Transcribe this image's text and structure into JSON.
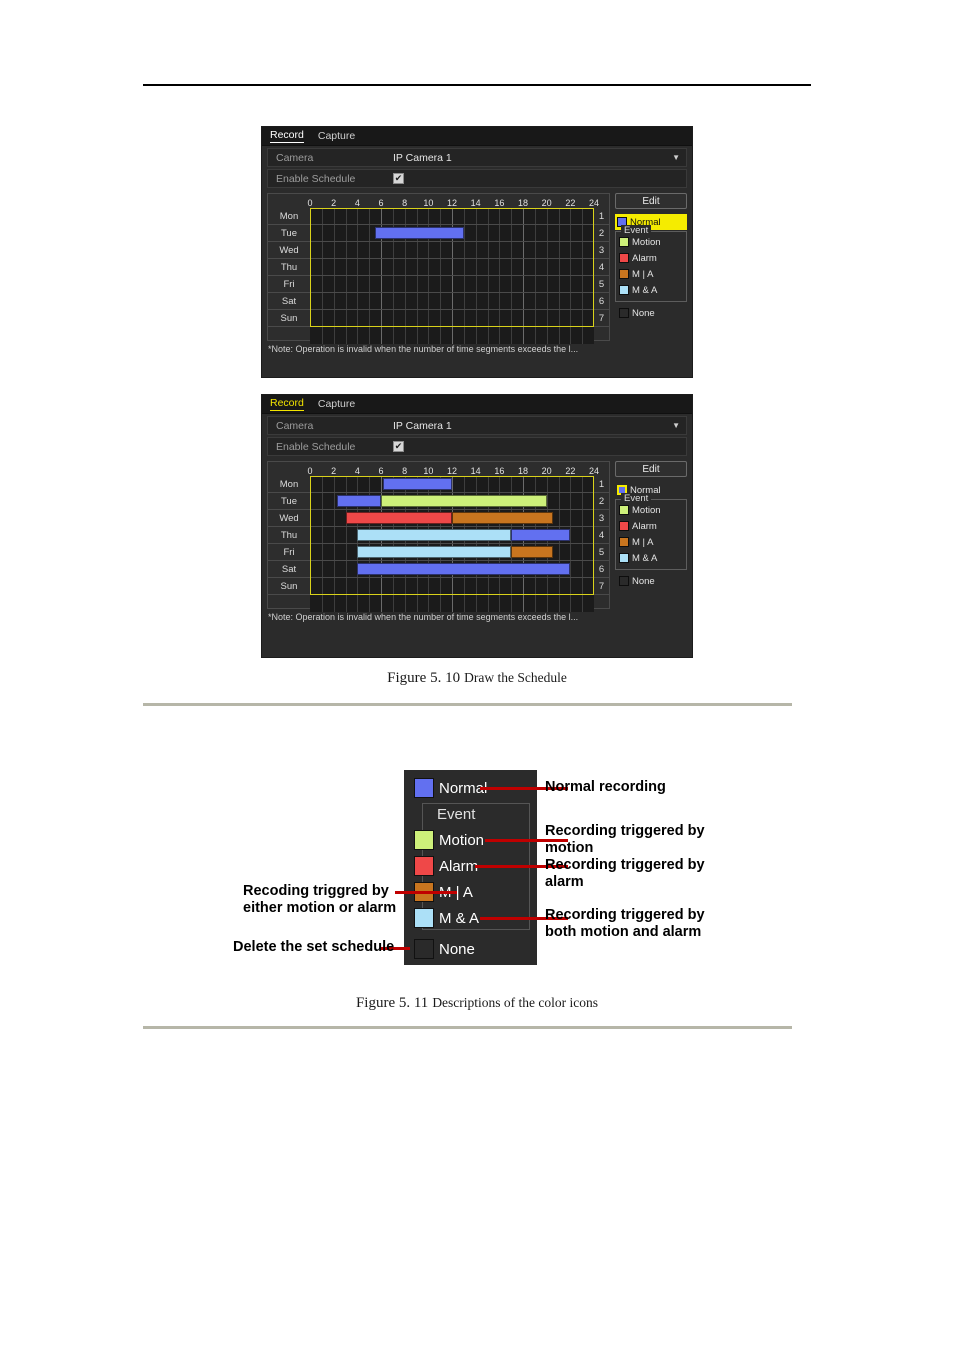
{
  "document": {
    "figure1_caption_label": "Figure 5. 10",
    "figure1_caption_text": "Draw the Schedule",
    "figure2_caption_label": "Figure 5. 11",
    "figure2_caption_text": "Descriptions of the color icons"
  },
  "colors": {
    "normal": "#6270f0",
    "motion": "#cdf07a",
    "alarm": "#ef4848",
    "m_or_a": "#c8751f",
    "m_and_a": "#ace0f7",
    "none": "#2a2a2a",
    "selected_outline": "#f5ec00",
    "schedule_frame": "#d9d21a"
  },
  "panel1": {
    "tabs": [
      {
        "label": "Record",
        "active": true
      },
      {
        "label": "Capture",
        "active": false
      }
    ],
    "camera_label": "Camera",
    "camera_value": "IP Camera 1",
    "enable_schedule_label": "Enable Schedule",
    "enable_schedule_checked": true,
    "hours": [
      "0",
      "2",
      "4",
      "6",
      "8",
      "10",
      "12",
      "14",
      "16",
      "18",
      "20",
      "22",
      "24"
    ],
    "days": [
      {
        "name": "Mon",
        "num": "1",
        "segments": []
      },
      {
        "name": "Tue",
        "num": "2",
        "segments": [
          {
            "type": "Normal",
            "start": 5.5,
            "end": 13.0
          }
        ]
      },
      {
        "name": "Wed",
        "num": "3",
        "segments": []
      },
      {
        "name": "Thu",
        "num": "4",
        "segments": []
      },
      {
        "name": "Fri",
        "num": "5",
        "segments": []
      },
      {
        "name": "Sat",
        "num": "6",
        "segments": []
      },
      {
        "name": "Sun",
        "num": "7",
        "segments": []
      }
    ],
    "edit_button": "Edit",
    "legend": {
      "normal_label": "Normal",
      "normal_state": "highlighted",
      "event_group_label": "Event",
      "event_items": [
        {
          "label": "Motion",
          "color_key": "motion"
        },
        {
          "label": "Alarm",
          "color_key": "alarm"
        },
        {
          "label": "M | A",
          "color_key": "m_or_a"
        },
        {
          "label": "M & A",
          "color_key": "m_and_a"
        }
      ],
      "none_label": "None"
    },
    "note": "*Note: Operation is invalid when the number of time segments exceeds the l..."
  },
  "panel2": {
    "tabs": [
      {
        "label": "Record",
        "active": true
      },
      {
        "label": "Capture",
        "active": false
      }
    ],
    "camera_label": "Camera",
    "camera_value": "IP Camera 1",
    "enable_schedule_label": "Enable Schedule",
    "enable_schedule_checked": true,
    "hours": [
      "0",
      "2",
      "4",
      "6",
      "8",
      "10",
      "12",
      "14",
      "16",
      "18",
      "20",
      "22",
      "24"
    ],
    "days": [
      {
        "name": "Mon",
        "num": "1",
        "segments": [
          {
            "type": "Normal",
            "start": 6.2,
            "end": 12.0
          }
        ]
      },
      {
        "name": "Tue",
        "num": "2",
        "segments": [
          {
            "type": "Normal",
            "start": 2.3,
            "end": 6.0
          },
          {
            "type": "Motion",
            "start": 6.0,
            "end": 20.0
          }
        ]
      },
      {
        "name": "Wed",
        "num": "3",
        "segments": [
          {
            "type": "Alarm",
            "start": 3.0,
            "end": 12.0
          },
          {
            "type": "M | A",
            "start": 12.0,
            "end": 20.5
          }
        ]
      },
      {
        "name": "Thu",
        "num": "4",
        "segments": [
          {
            "type": "M & A",
            "start": 4.0,
            "end": 17.0
          },
          {
            "type": "Normal",
            "start": 17.0,
            "end": 22.0
          }
        ]
      },
      {
        "name": "Fri",
        "num": "5",
        "segments": [
          {
            "type": "M & A",
            "start": 4.0,
            "end": 17.0
          },
          {
            "type": "M | A",
            "start": 17.0,
            "end": 20.5
          }
        ]
      },
      {
        "name": "Sat",
        "num": "6",
        "segments": [
          {
            "type": "Normal",
            "start": 4.0,
            "end": 22.0
          }
        ]
      },
      {
        "name": "Sun",
        "num": "7",
        "segments": []
      }
    ],
    "edit_button": "Edit",
    "legend": {
      "normal_label": "Normal",
      "normal_state": "selected-outline",
      "event_group_label": "Event",
      "event_items": [
        {
          "label": "Motion",
          "color_key": "motion"
        },
        {
          "label": "Alarm",
          "color_key": "alarm"
        },
        {
          "label": "M | A",
          "color_key": "m_or_a"
        },
        {
          "label": "M & A",
          "color_key": "m_and_a"
        }
      ],
      "none_label": "None"
    },
    "note": "*Note: Operation is invalid when the number of time segments exceeds the l..."
  },
  "diagram": {
    "items": [
      {
        "label": "Normal",
        "color_key": "normal"
      },
      {
        "label": "Motion",
        "color_key": "motion"
      },
      {
        "label": "Alarm",
        "color_key": "alarm"
      },
      {
        "label": "M | A",
        "color_key": "m_or_a"
      },
      {
        "label": "M & A",
        "color_key": "m_and_a"
      },
      {
        "label": "None",
        "color_key": "none"
      }
    ],
    "event_group_label": "Event",
    "callout_normal": "Normal recording",
    "callout_motion_l1": "Recording triggered by",
    "callout_motion_l2": "motion",
    "callout_alarm_l1": "Recording triggered by",
    "callout_alarm_l2": "alarm",
    "callout_mand_l1": "Recording triggered by",
    "callout_mand_l2": "both motion and alarm",
    "callout_mor_l1": "Recoding triggred by",
    "callout_mor_l2": "either motion or alarm",
    "callout_none": "Delete the set schedule"
  }
}
